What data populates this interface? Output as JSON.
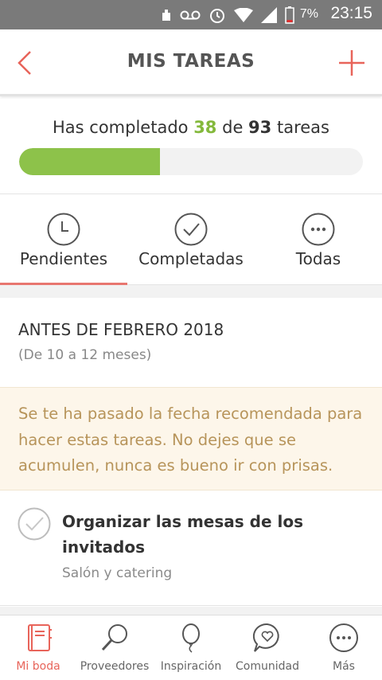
{
  "status_bar": {
    "battery": "7%",
    "time": "23:15"
  },
  "header": {
    "title": "MIS TAREAS",
    "back_icon": "chevron-left-icon",
    "add_icon": "plus-icon",
    "accent_color": "#e8645a"
  },
  "progress": {
    "text_before": "Has completado",
    "completed": "38",
    "text_middle": "de",
    "total": "93",
    "text_after": "tareas",
    "fraction": 0.409,
    "bar_color": "#8dc24a"
  },
  "tabs": [
    {
      "label": "Pendientes",
      "icon": "clock-icon",
      "active": true
    },
    {
      "label": "Completadas",
      "icon": "check-circle-icon",
      "active": false
    },
    {
      "label": "Todas",
      "icon": "more-circle-icon",
      "active": false
    }
  ],
  "section": {
    "title": "ANTES DE FEBRERO 2018",
    "subtitle": "(De 10 a 12 meses)"
  },
  "warning": {
    "text": "Se te ha pasado la fecha recomendada para hacer estas tareas. No dejes que se acumulen, nunca es bueno ir con prisas."
  },
  "task": {
    "title": "Organizar las mesas de los invitados",
    "category": "Salón y catering"
  },
  "bottom_nav": [
    {
      "label": "Mi boda",
      "icon": "notebook-icon",
      "active": true
    },
    {
      "label": "Proveedores",
      "icon": "search-icon",
      "active": false
    },
    {
      "label": "Inspiración",
      "icon": "balloon-icon",
      "active": false
    },
    {
      "label": "Comunidad",
      "icon": "chat-heart-icon",
      "active": false
    },
    {
      "label": "Más",
      "icon": "more-circle-icon",
      "active": false
    }
  ]
}
